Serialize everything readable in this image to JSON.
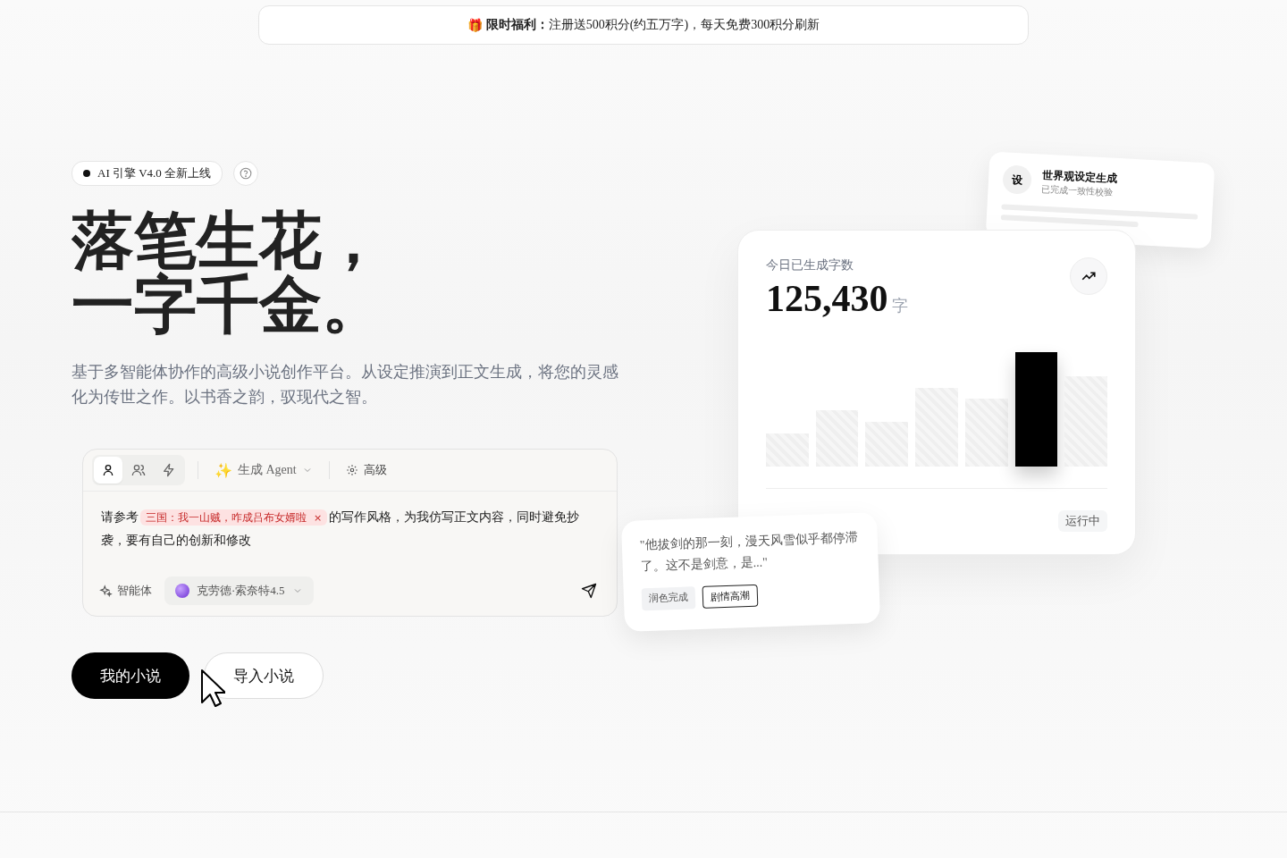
{
  "banner": {
    "icon": "🎁",
    "label": "限时福利：",
    "text": "注册送500积分(约五万字)，每天免费300积分刷新"
  },
  "hero": {
    "badge": "AI 引擎 V4.0 全新上线",
    "headline": [
      "落笔生花，",
      "一字千金。"
    ],
    "subtitle": "基于多智能体协作的高级小说创作平台。从设定推演到正文生成，将您的灵感化为传世之作。以书香之韵，驭现代之智。"
  },
  "composer": {
    "mode_tabs": [
      {
        "kind": "person",
        "selected": true
      },
      {
        "kind": "people",
        "selected": false
      },
      {
        "kind": "bolt",
        "selected": false
      }
    ],
    "agent_icon": "✨",
    "agent_menu": "生成 Agent",
    "advanced": "高级",
    "prompt_before": "请参考",
    "reference_tag": "三国：我一山贼，咋成吕布女婿啦",
    "tag_remove": "×",
    "prompt_after": "的写作风格，为我仿写正文内容，同时避免抄袭，要有自己的创新和修改",
    "agent_button": "智能体",
    "model": "克劳德·索奈特4.5"
  },
  "actions": [
    {
      "label": "我的小说",
      "kind": "primary"
    },
    {
      "label": "导入小说",
      "kind": "secondary"
    }
  ],
  "stats_card": {
    "label": "今日已生成字数",
    "value": "125,430",
    "unit": "字",
    "status": "运行中"
  },
  "task_card": {
    "avatar": "设",
    "title": "世界观设定生成",
    "subtitle": "已完成一致性校验"
  },
  "quote_card": {
    "text": "\"他拔剑的那一刻，漫天风雪似乎都停滞了。这不是剑意，是...\"",
    "tags": [
      {
        "label": "润色完成",
        "kind": "muted"
      },
      {
        "label": "剧情高潮",
        "kind": "outlined"
      }
    ]
  }
}
